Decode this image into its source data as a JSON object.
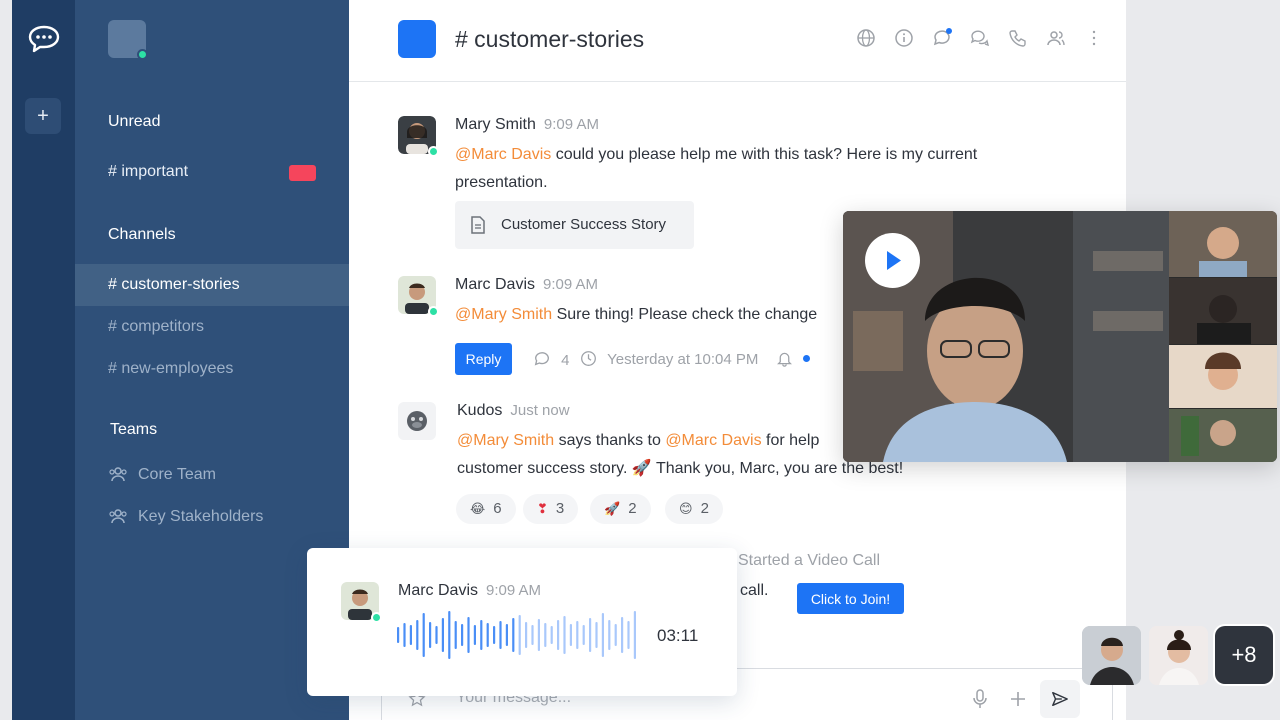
{
  "rail": {
    "logo_icon": "rocket-chat-bubble-icon",
    "add_icon": "plus-icon",
    "add_label": "+"
  },
  "sidebar": {
    "unread_heading": "Unread",
    "unread_items": [
      {
        "label": "# important"
      }
    ],
    "channels_heading": "Channels",
    "channels": [
      {
        "label": "# customer-stories"
      },
      {
        "label": "# competitors"
      },
      {
        "label": "# new-employees"
      }
    ],
    "teams_heading": "Teams",
    "teams": [
      {
        "label": "Core Team"
      },
      {
        "label": "Key Stakeholders"
      }
    ]
  },
  "header": {
    "title": "# customer-stories",
    "icons": [
      "globe-icon",
      "info-icon",
      "threads-icon",
      "discussion-icon",
      "phone-icon",
      "members-icon",
      "kebab-icon"
    ]
  },
  "messages": [
    {
      "author": "Mary Smith",
      "time": "9:09 AM",
      "mention": "@Marc Davis",
      "text_a": " could you please help me with this task? Here is my current",
      "text_b": "presentation.",
      "attachment": "Customer Success Story"
    },
    {
      "author": "Marc Davis",
      "time": "9:09 AM",
      "mention": "@Mary Smith",
      "text": " Sure thing! Please check the change",
      "reply_label": "Reply",
      "thread_count": "4",
      "last_reply": "Yesterday at 10:04 PM"
    },
    {
      "author": "Kudos",
      "time": "Just now",
      "mention_a": "@Mary Smith",
      "text_a": " says thanks to ",
      "mention_b": "@Marc Davis",
      "text_b": " for help",
      "text_c": "customer success story. 🚀 Thank you, Marc, you are the best!",
      "reactions": [
        {
          "emoji": "😂",
          "count": "6"
        },
        {
          "emoji": "❣",
          "count": "3"
        },
        {
          "emoji": "🚀",
          "count": "2"
        },
        {
          "emoji": "😊",
          "count": "2"
        }
      ]
    }
  ],
  "video_call": {
    "started_text": "Started a Video Call",
    "partial_text": "call.",
    "join_label": "Click to Join!"
  },
  "voice_message": {
    "author": "Marc Davis",
    "time": "9:09 AM",
    "duration": "03:11"
  },
  "composer": {
    "placeholder": "Your message..."
  },
  "participants": {
    "more_label": "+8"
  },
  "colors": {
    "accent": "#1d74f5",
    "sidebar": "#2f5079",
    "rail": "#1f3d64",
    "mention": "#f38c39",
    "online": "#2de0a5",
    "badge": "#f5455c"
  }
}
